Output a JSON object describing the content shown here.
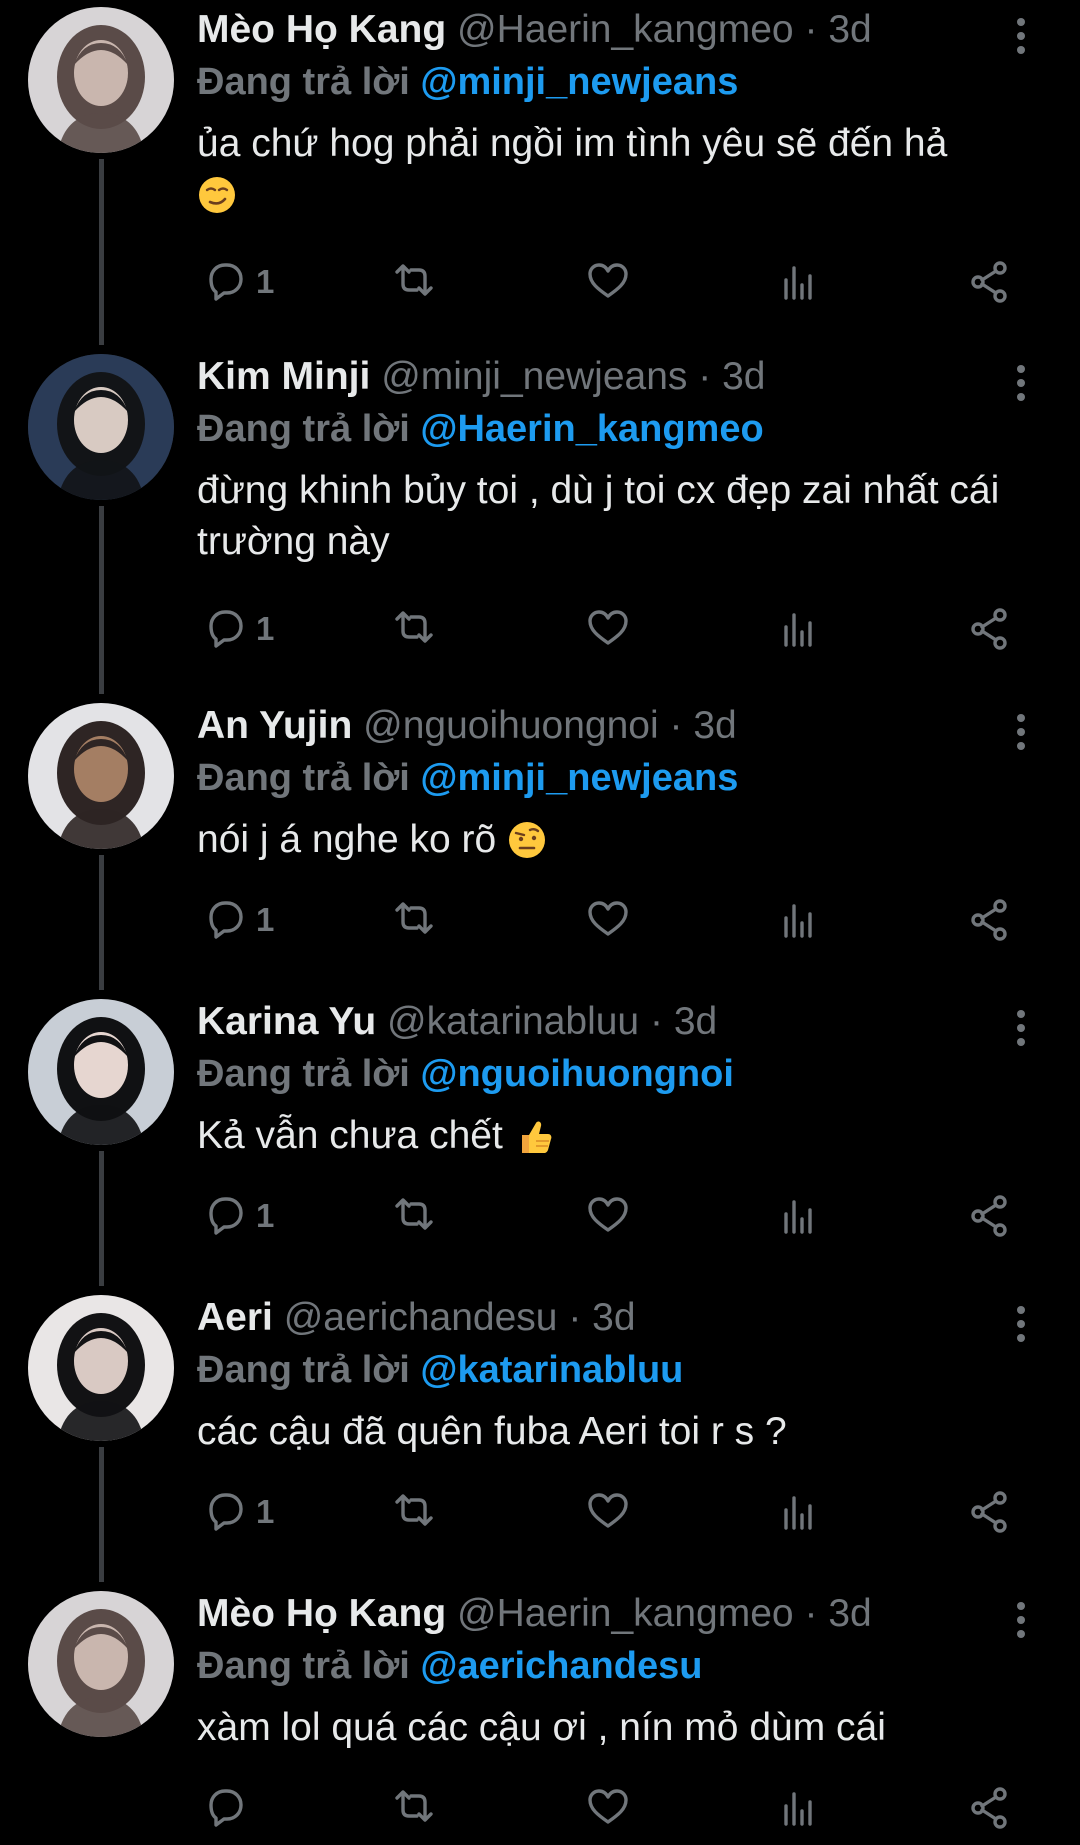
{
  "thread": {
    "reply_prefix": "Đang trả lời",
    "colors": {
      "background": "#000000",
      "text": "#e7e9ea",
      "muted": "#71767b",
      "link": "#1d9bf0",
      "thread_line": "#3a3d41"
    },
    "tweets": [
      {
        "name": "Mèo Họ Kang",
        "handle": "@Haerin_kangmeo",
        "separator": "·",
        "time": "3d",
        "reply_to": "@minji_newjeans",
        "text": "ủa chứ hog phải ngồi im tình yêu sẽ đến hả",
        "emoji": "smirking-face",
        "reply_count": "1",
        "avatar": "avatar-photo"
      },
      {
        "name": "Kim Minji",
        "handle": "@minji_newjeans",
        "separator": "·",
        "time": "3d",
        "reply_to": "@Haerin_kangmeo",
        "text": "đừng khinh bủy toi , dù j toi cx đẹp zai nhất cái trường này",
        "emoji": "",
        "reply_count": "1",
        "avatar": "avatar-photo"
      },
      {
        "name": "An Yujin",
        "handle": "@nguoihuongnoi",
        "separator": "·",
        "time": "3d",
        "reply_to": "@minji_newjeans",
        "text": "nói j á nghe ko rõ",
        "emoji": "face-with-raised-eyebrow",
        "reply_count": "1",
        "avatar": "avatar-photo"
      },
      {
        "name": "Karina Yu",
        "handle": "@katarinabluu",
        "separator": "·",
        "time": "3d",
        "reply_to": "@nguoihuongnoi",
        "text": "Kả vẫn chưa chết",
        "emoji": "thumbs-up",
        "reply_count": "1",
        "avatar": "avatar-photo"
      },
      {
        "name": "Aeri",
        "handle": "@aerichandesu",
        "separator": "·",
        "time": "3d",
        "reply_to": "@katarinabluu",
        "text": "các cậu đã quên fuba Aeri toi r s ?",
        "emoji": "",
        "reply_count": "1",
        "avatar": "avatar-photo"
      },
      {
        "name": "Mèo Họ Kang",
        "handle": "@Haerin_kangmeo",
        "separator": "·",
        "time": "3d",
        "reply_to": "@aerichandesu",
        "text": "xàm lol quá các cậu ơi , nín mỏ dùm cái",
        "emoji": "",
        "reply_count": "",
        "avatar": "avatar-photo"
      }
    ],
    "action_icons": [
      "reply-icon",
      "retweet-icon",
      "like-icon",
      "views-icon",
      "share-icon"
    ]
  }
}
